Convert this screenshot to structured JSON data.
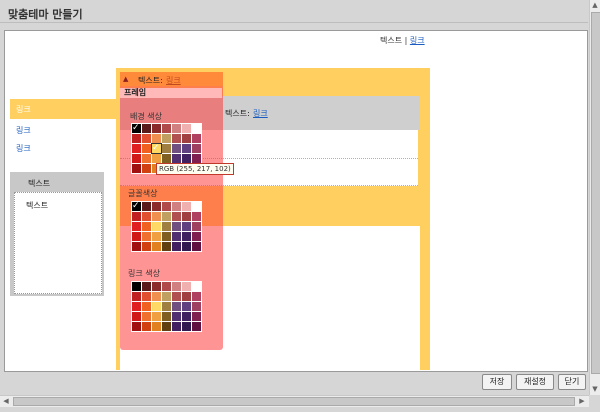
{
  "window": {
    "title": "맞춤테마 만들기"
  },
  "top_links": {
    "text_label": "텍스트",
    "separator": "|",
    "link_label": "링크"
  },
  "sidebar": {
    "items": [
      {
        "label": "링크"
      },
      {
        "label": "링크"
      },
      {
        "label": "링크"
      }
    ],
    "box": {
      "title": "텍스트",
      "body": "텍스트"
    }
  },
  "main": {
    "header_text": "텍스트:",
    "header_link": "링크"
  },
  "picker": {
    "header_text": "텍스트:",
    "header_link": "링크",
    "frame_label": "프레임",
    "sections": [
      {
        "title": "배경 색상"
      },
      {
        "title": "글꼴색상"
      },
      {
        "title": "링크 색상"
      }
    ],
    "tooltip": "RGB (255, 217, 102)",
    "palette": [
      [
        "#000000",
        "#5a1a1a",
        "#8a2a2a",
        "#b04a4a",
        "#d08080",
        "#f0b0b0",
        "#ffffff"
      ],
      [
        "#c02020",
        "#e05030",
        "#f09050",
        "#c0a060",
        "#b05050",
        "#a04040",
        "#b04060"
      ],
      [
        "#e02020",
        "#f06020",
        "#ffd966",
        "#a08040",
        "#705080",
        "#604080",
        "#a04060"
      ],
      [
        "#d01818",
        "#f07030",
        "#f0a040",
        "#806020",
        "#503070",
        "#402060",
        "#802050"
      ],
      [
        "#a01010",
        "#d04010",
        "#e08020",
        "#604010",
        "#402060",
        "#301850",
        "#601040"
      ]
    ]
  },
  "footer": {
    "save": "저장",
    "reset": "재설정",
    "close": "닫기"
  },
  "colors": {
    "accent_yellow": "#ffd060",
    "overlay_red": "#ff3c3c",
    "link_blue": "#1a5cbf"
  },
  "icons": {
    "collapse": "triangle-up-icon"
  }
}
